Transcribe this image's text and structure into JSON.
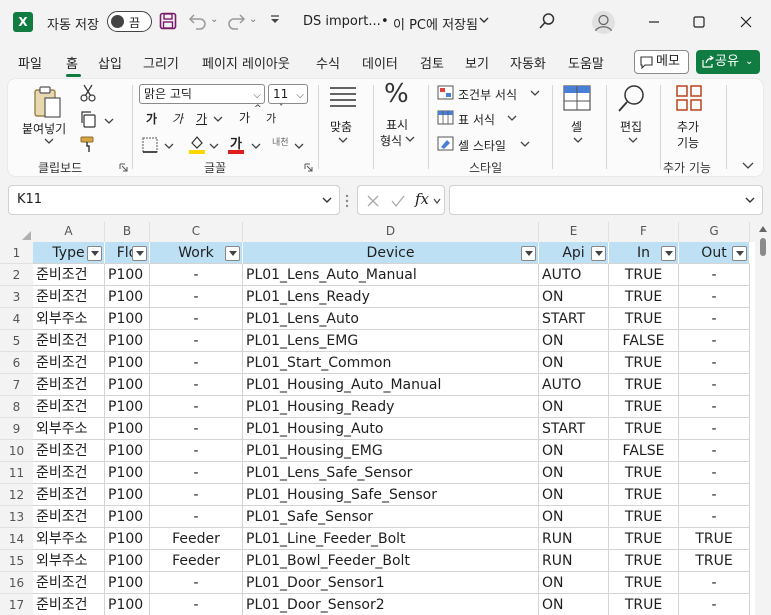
{
  "titlebar": {
    "logo": "X",
    "autosave_label": "자동 저장",
    "autosave_state": "끔",
    "filename": "DS import...",
    "dot": "•",
    "saved_status": "이 PC에 저장됨",
    "icons": [
      "save-icon",
      "undo-icon",
      "redo-icon",
      "customize-icon",
      "search-icon",
      "avatar",
      "minimize-icon",
      "maximize-icon",
      "close-icon"
    ]
  },
  "tabs": {
    "items": [
      "파일",
      "홈",
      "삽입",
      "그리기",
      "페이지 레이아웃",
      "수식",
      "데이터",
      "검토",
      "보기",
      "자동화",
      "도움말"
    ],
    "active": "홈",
    "memo_label": "메모",
    "share_label": "공유",
    "accent": "#107c41"
  },
  "ribbon": {
    "clipboard": {
      "paste_label": "붙여넣기",
      "group_label": "클립보드"
    },
    "font": {
      "font_name": "맑은 고딕",
      "font_size": "11",
      "bold": "가",
      "italic": "가",
      "underline": "가",
      "grow": "가",
      "shrink": "가",
      "font_color": "가",
      "phonetic": "내천",
      "group_label": "글꼴"
    },
    "alignment": {
      "label": "맞춤"
    },
    "number": {
      "label_line1": "표시",
      "label_line2": "형식"
    },
    "styles": {
      "conditional": "조건부 서식",
      "table": "표 서식",
      "cell_style": "셀 스타일",
      "group_label": "스타일"
    },
    "cells": {
      "label": "셀"
    },
    "editing": {
      "label": "편집"
    },
    "addins": {
      "label_line1": "추가",
      "label_line2": "기능",
      "group_label": "추가 기능"
    }
  },
  "formulabar": {
    "namebox": "K11",
    "formula": ""
  },
  "grid": {
    "columns": [
      "A",
      "B",
      "C",
      "D",
      "E",
      "F",
      "G"
    ],
    "header_row": [
      "Type",
      "Flo",
      "Work",
      "Device",
      "Api",
      "In",
      "Out"
    ],
    "rows": [
      {
        "n": "2",
        "cells": [
          "준비조건",
          "P100",
          "-",
          "PL01_Lens_Auto_Manual",
          "AUTO",
          "TRUE",
          "-"
        ]
      },
      {
        "n": "3",
        "cells": [
          "준비조건",
          "P100",
          "-",
          "PL01_Lens_Ready",
          "ON",
          "TRUE",
          "-"
        ]
      },
      {
        "n": "4",
        "cells": [
          "외부주소",
          "P100",
          "-",
          "PL01_Lens_Auto",
          "START",
          "TRUE",
          "-"
        ]
      },
      {
        "n": "5",
        "cells": [
          "준비조건",
          "P100",
          "-",
          "PL01_Lens_EMG",
          "ON",
          "FALSE",
          "-"
        ]
      },
      {
        "n": "6",
        "cells": [
          "준비조건",
          "P100",
          "-",
          "PL01_Start_Common",
          "ON",
          "TRUE",
          "-"
        ]
      },
      {
        "n": "7",
        "cells": [
          "준비조건",
          "P100",
          "-",
          "PL01_Housing_Auto_Manual",
          "AUTO",
          "TRUE",
          "-"
        ]
      },
      {
        "n": "8",
        "cells": [
          "준비조건",
          "P100",
          "-",
          "PL01_Housing_Ready",
          "ON",
          "TRUE",
          "-"
        ]
      },
      {
        "n": "9",
        "cells": [
          "외부주소",
          "P100",
          "-",
          "PL01_Housing_Auto",
          "START",
          "TRUE",
          "-"
        ]
      },
      {
        "n": "10",
        "cells": [
          "준비조건",
          "P100",
          "-",
          "PL01_Housing_EMG",
          "ON",
          "FALSE",
          "-"
        ]
      },
      {
        "n": "11",
        "cells": [
          "준비조건",
          "P100",
          "-",
          "PL01_Lens_Safe_Sensor",
          "ON",
          "TRUE",
          "-"
        ]
      },
      {
        "n": "12",
        "cells": [
          "준비조건",
          "P100",
          "-",
          "PL01_Housing_Safe_Sensor",
          "ON",
          "TRUE",
          "-"
        ]
      },
      {
        "n": "13",
        "cells": [
          "준비조건",
          "P100",
          "-",
          "PL01_Safe_Sensor",
          "ON",
          "TRUE",
          "-"
        ]
      },
      {
        "n": "14",
        "cells": [
          "외부주소",
          "P100",
          "Feeder",
          "PL01_Line_Feeder_Bolt",
          "RUN",
          "TRUE",
          "TRUE"
        ]
      },
      {
        "n": "15",
        "cells": [
          "외부주소",
          "P100",
          "Feeder",
          "PL01_Bowl_Feeder_Bolt",
          "RUN",
          "TRUE",
          "TRUE"
        ]
      },
      {
        "n": "16",
        "cells": [
          "준비조건",
          "P100",
          "-",
          "PL01_Door_Sensor1",
          "ON",
          "TRUE",
          "-"
        ]
      },
      {
        "n": "17",
        "cells": [
          "준비조건",
          "P100",
          "-",
          "PL01_Door_Sensor2",
          "ON",
          "TRUE",
          "-"
        ]
      }
    ],
    "header_fill": "#bde0f4"
  }
}
